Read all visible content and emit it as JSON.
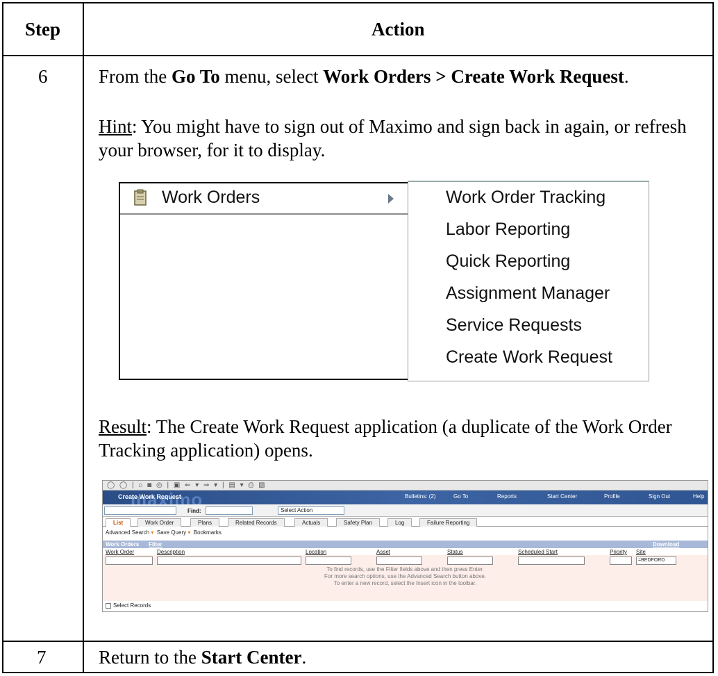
{
  "table": {
    "header": {
      "step": "Step",
      "action": "Action"
    },
    "row6": {
      "step": "6",
      "instruction": {
        "pre": "From the ",
        "goto": "Go To",
        "mid": " menu, select ",
        "path": "Work Orders > Create Work Request",
        "post": "."
      },
      "hint": {
        "label": "Hint",
        "text": ": You might have to sign out of Maximo and sign back in again, or refresh your browser, for it to display."
      },
      "result": {
        "label": "Result",
        "text": ": The Create Work Request application (a duplicate of the Work Order Tracking application) opens."
      }
    },
    "row7": {
      "step": "7",
      "pre": "Return to the ",
      "bold": "Start Center",
      "post": "."
    }
  },
  "goto_menu": {
    "parent_item": "Work Orders",
    "parent_icon": "clipboard-icon",
    "submenu_items": [
      "Work Order Tracking",
      "Labor Reporting",
      "Quick Reporting",
      "Assignment Manager",
      "Service Requests",
      "Create Work Request"
    ]
  },
  "maximo": {
    "app_title": "Create Work Request",
    "watermark": "maximo",
    "nav": {
      "bulletins": "Bulletins: (2)",
      "goto": "Go To",
      "reports": "Reports",
      "start_center": "Start Center",
      "profile": "Profile",
      "sign_out": "Sign Out",
      "help": "Help"
    },
    "toolbar": {
      "find_label": "Find:",
      "select_action": "Select Action"
    },
    "tabs": [
      "List",
      "Work Order",
      "Plans",
      "Related Records",
      "Actuals",
      "Safety Plan",
      "Log",
      "Failure Reporting"
    ],
    "links": {
      "advanced_search": "Advanced Search",
      "save_query": "Save Query",
      "bookmarks": "Bookmarks"
    },
    "section": {
      "title": "Work Orders",
      "filter": "Filter",
      "download": "Download"
    },
    "columns": [
      "Work Order",
      "Description",
      "Location",
      "Asset",
      "Status",
      "Scheduled Start",
      "Priority",
      "Site"
    ],
    "site_filter_value": "=BEDFORD",
    "messages": [
      "To find records, use the Filter fields above and then press Enter.",
      "For more search options, use the Advanced Search button above.",
      "To enter a new record, select the Insert icon in the toolbar."
    ],
    "select_records": "Select Records"
  }
}
